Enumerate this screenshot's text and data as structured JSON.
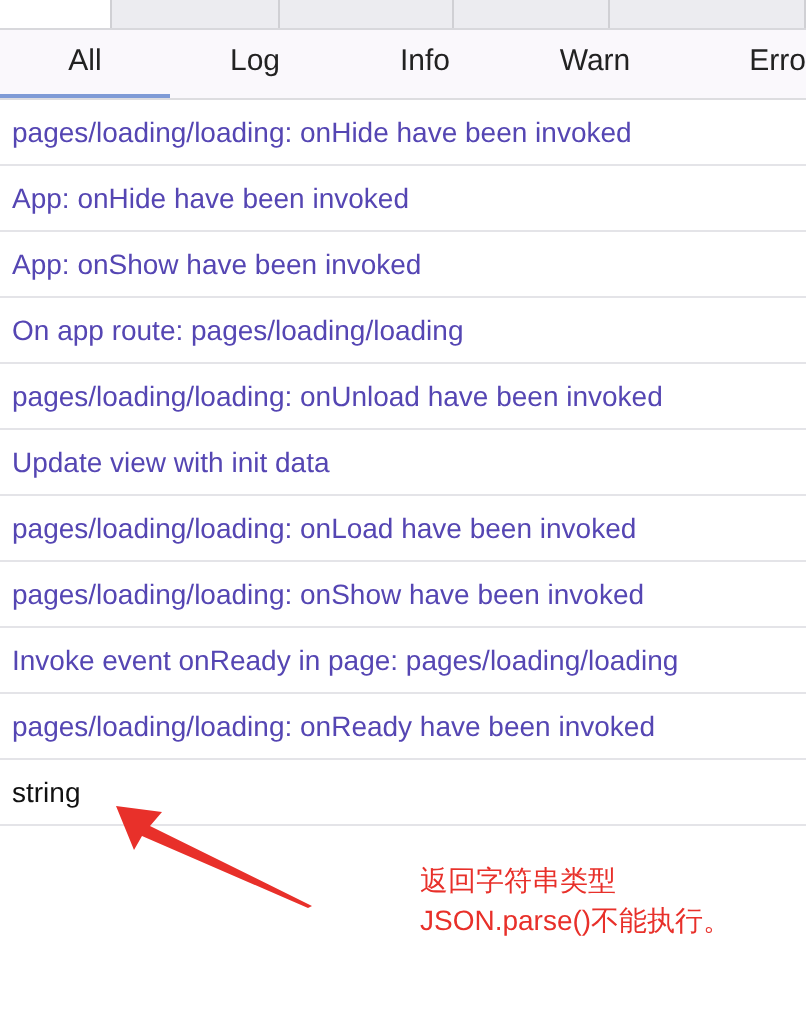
{
  "top_tabs": [
    {
      "selected": true
    },
    {
      "selected": false
    },
    {
      "selected": false
    },
    {
      "selected": false
    },
    {
      "selected": false
    }
  ],
  "filter_tabs": [
    {
      "label": "All",
      "selected": true
    },
    {
      "label": "Log",
      "selected": false
    },
    {
      "label": "Info",
      "selected": false
    },
    {
      "label": "Warn",
      "selected": false
    },
    {
      "label": "Erro",
      "selected": false
    }
  ],
  "log_rows": [
    {
      "kind": "system",
      "text": "pages/loading/loading: onHide have been invoked"
    },
    {
      "kind": "system",
      "text": "App: onHide have been invoked"
    },
    {
      "kind": "system",
      "text": "App: onShow have been invoked"
    },
    {
      "kind": "system",
      "text": "On app route: pages/loading/loading"
    },
    {
      "kind": "system",
      "text": "pages/loading/loading: onUnload have been invoked"
    },
    {
      "kind": "system",
      "text": "Update view with init data"
    },
    {
      "kind": "system",
      "text": "pages/loading/loading: onLoad have been invoked"
    },
    {
      "kind": "system",
      "text": "pages/loading/loading: onShow have been invoked"
    },
    {
      "kind": "system",
      "text": "Invoke event onReady in page: pages/loading/loading"
    },
    {
      "kind": "system",
      "text": "pages/loading/loading: onReady have been invoked"
    },
    {
      "kind": "output",
      "text": "string"
    }
  ],
  "annotation": {
    "lines": [
      "返回字符串类型",
      "JSON.parse()不能执行。"
    ]
  }
}
